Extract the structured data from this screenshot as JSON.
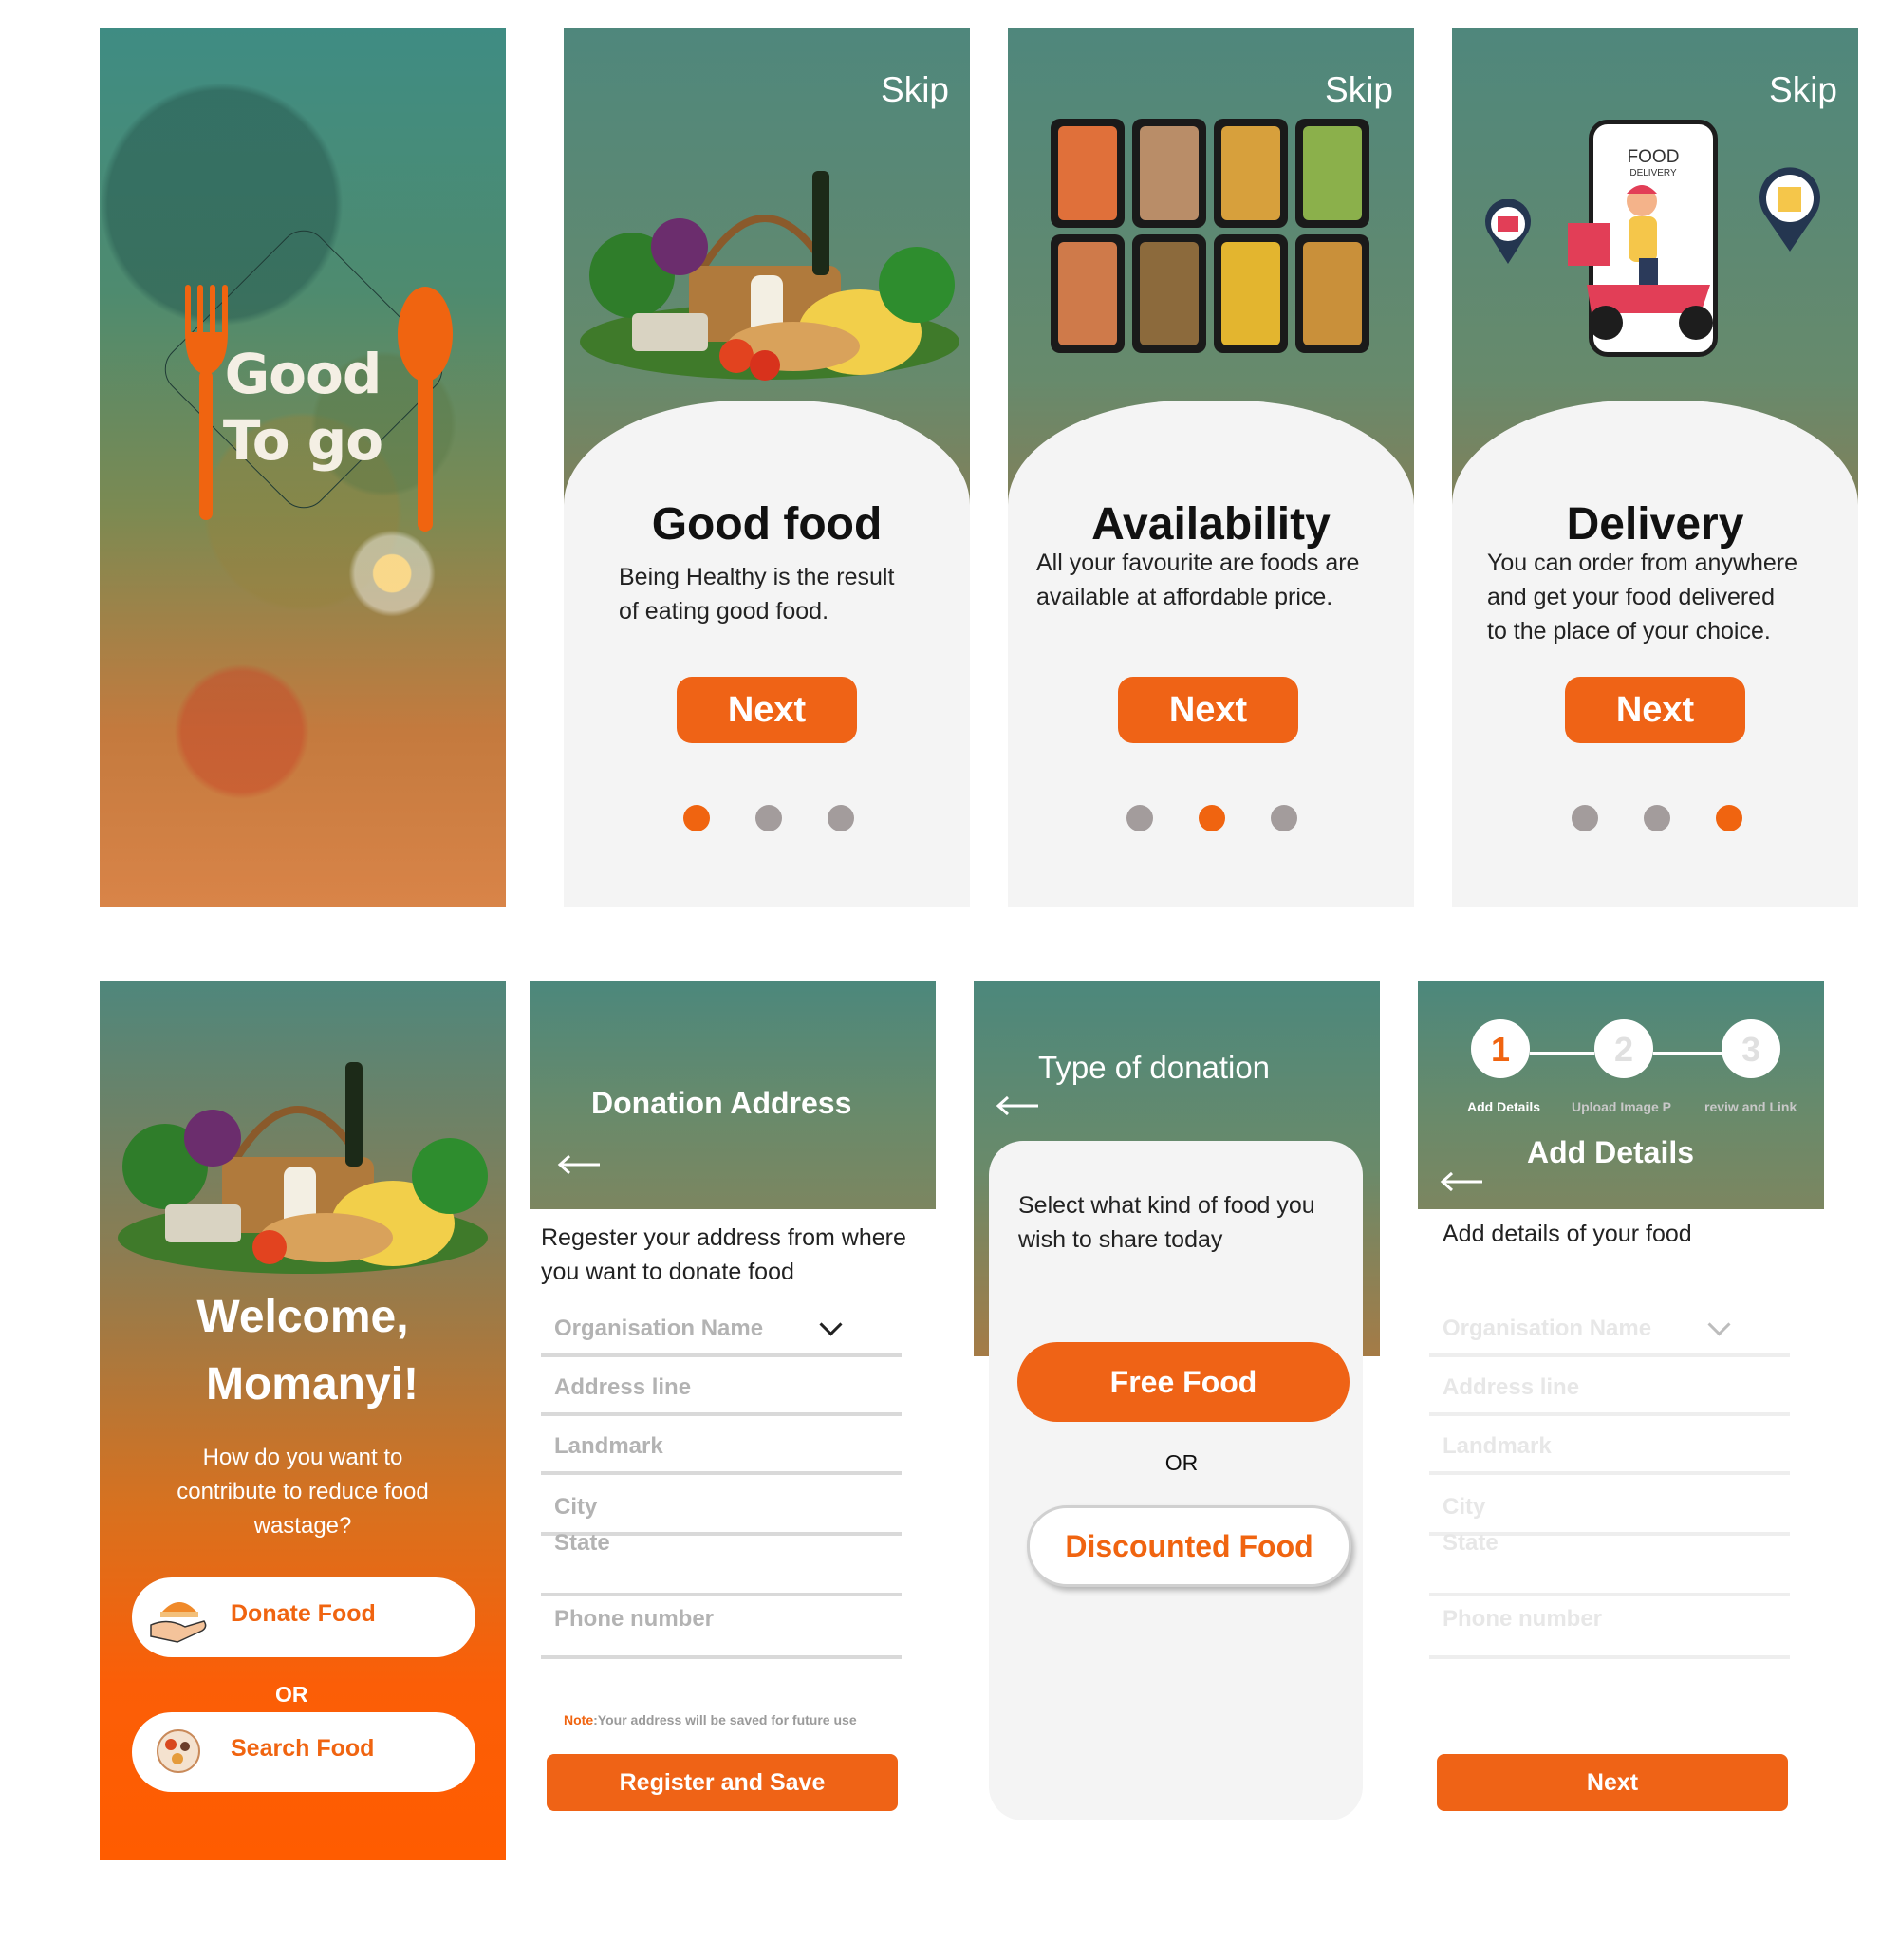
{
  "splash": {
    "logo_line1": "Good",
    "logo_line2": "To go"
  },
  "onboarding": [
    {
      "skip": "Skip",
      "title": "Good food",
      "text_line1": "Being Healthy is the result",
      "text_line2": "of eating good food.",
      "text_line3": "",
      "next": "Next",
      "active_dot": 0
    },
    {
      "skip": "Skip",
      "title": "Availability",
      "text_line1": "All your  favourite are foods are",
      "text_line2": "available at affordable price.",
      "text_line3": "",
      "next": "Next",
      "active_dot": 1
    },
    {
      "skip": "Skip",
      "title": "Delivery",
      "text_line1": "You can order from anywhere",
      "text_line2": "and get your food delivered",
      "text_line3": "to the place of your choice.",
      "next": "Next",
      "active_dot": 2
    }
  ],
  "phone_illustration": {
    "line1": "FOOD",
    "line2": "DELIVERY"
  },
  "welcome": {
    "greeting_line1": "Welcome,",
    "greeting_line2": "Momanyi!",
    "question_line1": "How do you want to",
    "question_line2": "contribute to reduce food",
    "question_line3": "wastage?",
    "donate_label": "Donate Food",
    "or": "OR",
    "search_label": "Search Food"
  },
  "donation_address": {
    "title": "Donation Address",
    "intro_line1": "Regester your address from where",
    "intro_line2": "you want to donate food",
    "fields": [
      "Organisation Name",
      "Address line",
      "Landmark",
      "City",
      "State",
      "Phone number"
    ],
    "note_label": "Note",
    "note_text": ":Your address will be saved for future use",
    "submit": "Register and Save"
  },
  "donation_type": {
    "title": "Type of donation",
    "prompt_line1": "Select what kind of food you",
    "prompt_line2": "wish to share today",
    "free_label": "Free Food",
    "or": "OR",
    "discounted_label": "Discounted Food"
  },
  "add_details": {
    "steps": [
      {
        "number": "1",
        "label": "Add Details"
      },
      {
        "number": "2",
        "label": "Upload Image P"
      },
      {
        "number": "3",
        "label": "reviw and Link"
      }
    ],
    "title": "Add Details",
    "intro": "Add details of your food",
    "fields": [
      "Organisation Name",
      "Address line",
      "Landmark",
      "City",
      "State",
      "Phone number"
    ],
    "next": "Next"
  },
  "colors": {
    "accent": "#ef6316",
    "teal": "#4f877c",
    "panel": "#f4f4f4",
    "dot_inactive": "#a39c9c"
  }
}
